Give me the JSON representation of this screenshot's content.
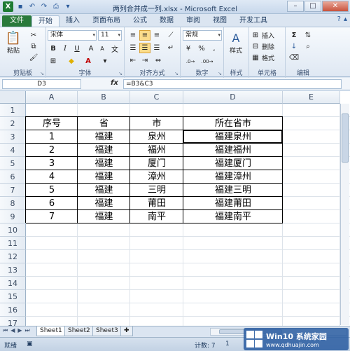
{
  "window": {
    "title": "两列合并成一列.xlsx - Microsoft Excel",
    "app_icon": "X"
  },
  "ribbon_tabs": [
    "文件",
    "开始",
    "插入",
    "页面布局",
    "公式",
    "数据",
    "审阅",
    "视图",
    "开发工具"
  ],
  "active_tab": "开始",
  "clipboard": {
    "paste": "粘贴",
    "label": "剪贴板"
  },
  "font": {
    "name": "宋体",
    "size": "11",
    "label": "字体",
    "bold": "B",
    "italic": "I",
    "underline": "U",
    "grow": "A",
    "shrink": "A"
  },
  "alignment": {
    "label": "对齐方式"
  },
  "number": {
    "format": "常规",
    "percent": "%",
    "comma": ",",
    "label": "数字"
  },
  "styles": {
    "label": "样式",
    "button": "样式"
  },
  "cells": {
    "insert": "插入",
    "delete": "删除",
    "format": "格式",
    "label": "单元格"
  },
  "editing": {
    "label": "编辑",
    "sum": "Σ"
  },
  "formula_bar": {
    "name_box": "D3",
    "fx": "fx",
    "formula": "=B3&C3"
  },
  "columns": [
    "A",
    "B",
    "C",
    "D",
    "E"
  ],
  "rows": [
    "1",
    "2",
    "3",
    "4",
    "5",
    "6",
    "7",
    "8",
    "9",
    "10",
    "11",
    "12",
    "13",
    "14",
    "15",
    "16",
    "17"
  ],
  "table": {
    "header": [
      "序号",
      "省",
      "市",
      "所在省市"
    ],
    "rows": [
      [
        "1",
        "福建",
        "泉州",
        "福建泉州"
      ],
      [
        "2",
        "福建",
        "福州",
        "福建福州"
      ],
      [
        "3",
        "福建",
        "厦门",
        "福建厦门"
      ],
      [
        "4",
        "福建",
        "漳州",
        "福建漳州"
      ],
      [
        "5",
        "福建",
        "三明",
        "福建三明"
      ],
      [
        "6",
        "福建",
        "莆田",
        "福建莆田"
      ],
      [
        "7",
        "福建",
        "南平",
        "福建南平"
      ]
    ]
  },
  "sheets": [
    "Sheet1",
    "Sheet2",
    "Sheet3"
  ],
  "active_sheet": "Sheet1",
  "status": {
    "ready": "就绪",
    "count": "计数: 7",
    "zoom": "1"
  },
  "watermark": {
    "line1": "Win10 系统家园",
    "line2": "www.qdhuajin.com"
  }
}
